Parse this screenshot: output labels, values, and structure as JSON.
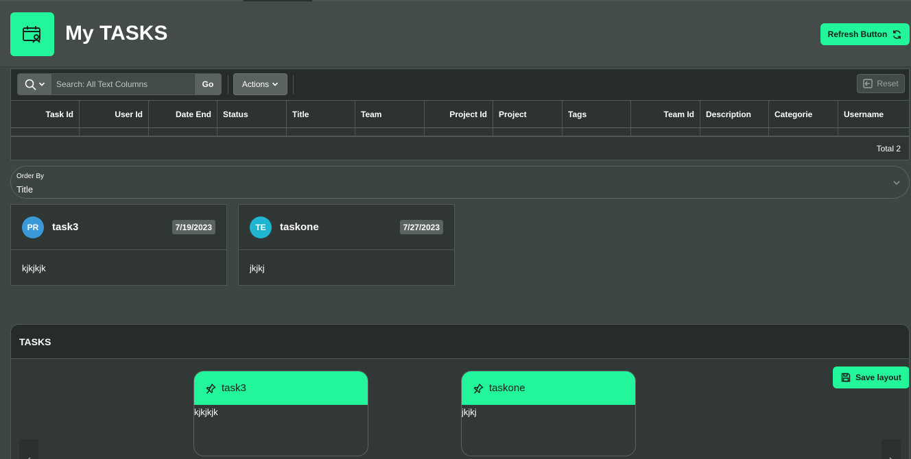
{
  "page": {
    "title": "My TASKS"
  },
  "header": {
    "refresh_label": "Refresh Button"
  },
  "toolbar": {
    "search_placeholder": "Search: All Text Columns",
    "go_label": "Go",
    "actions_label": "Actions",
    "reset_label": "Reset"
  },
  "grid": {
    "columns": [
      "Task Id",
      "User Id",
      "Date End",
      "Status",
      "Title",
      "Team",
      "Project Id",
      "Project",
      "Tags",
      "Team Id",
      "Description",
      "Categorie",
      "Username"
    ],
    "total_label": "Total 2"
  },
  "orderby": {
    "label": "Order By",
    "value": "Title"
  },
  "cards": [
    {
      "initials": "PR",
      "title": "task3",
      "date": "7/19/2023",
      "body": "kjkjkjk",
      "avatar_color": "#3a9ad9"
    },
    {
      "initials": "TE",
      "title": "taskone",
      "date": "7/27/2023",
      "body": "jkjkj",
      "avatar_color": "#1fb5d0"
    }
  ],
  "tasks_region": {
    "title": "TASKS",
    "save_layout_label": "Save layout",
    "items": [
      {
        "title": "task3",
        "body": "kjkjkjk"
      },
      {
        "title": "taskone",
        "body": "jkjkj"
      }
    ]
  },
  "colors": {
    "accent": "#22f59a",
    "background": "#3d4643"
  }
}
